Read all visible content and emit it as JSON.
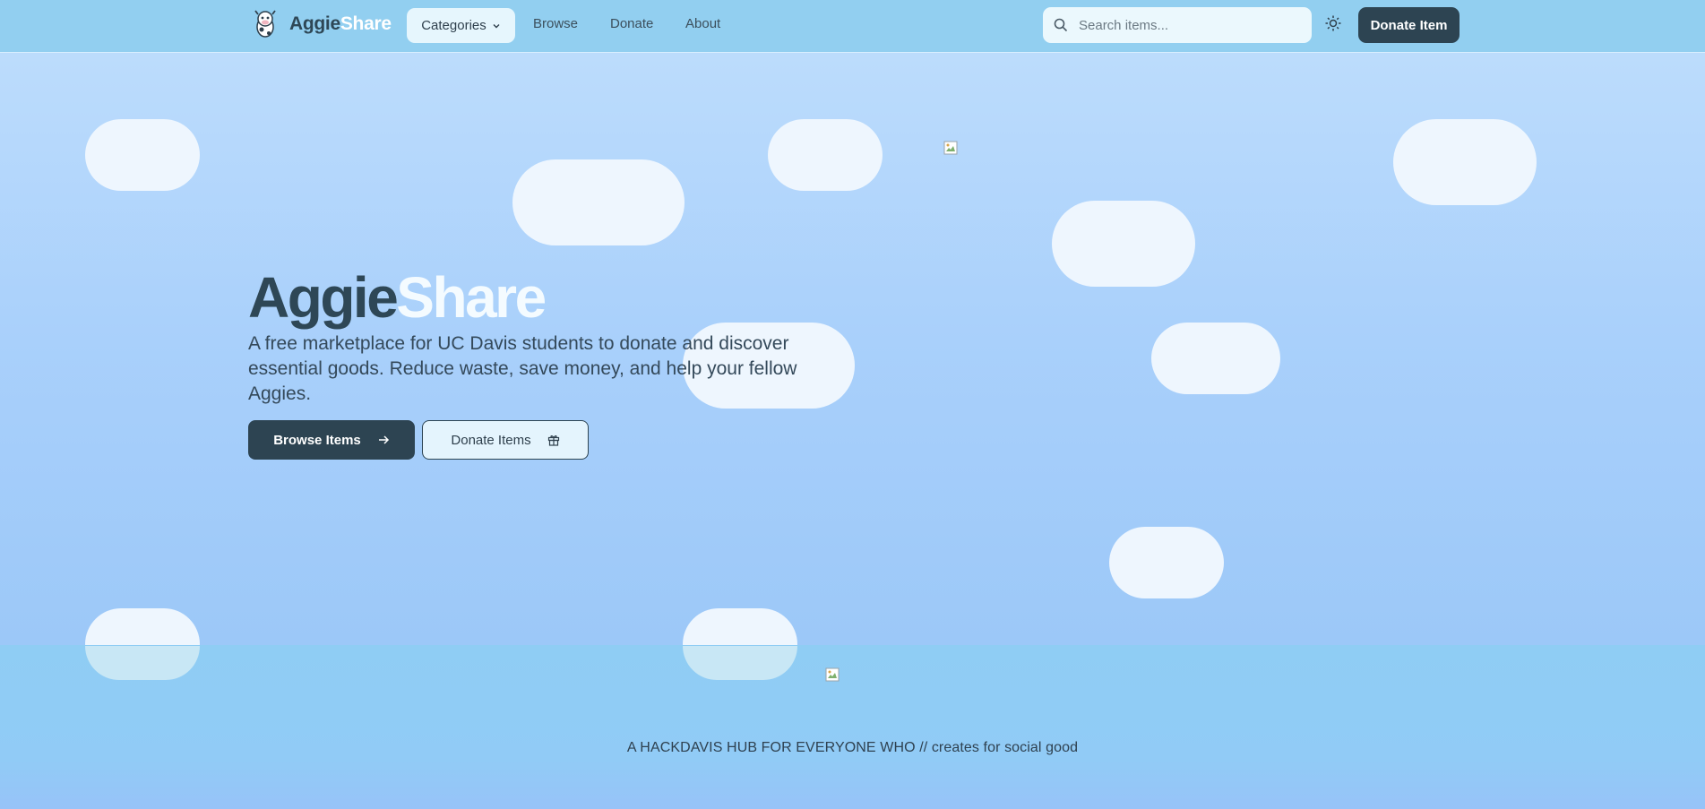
{
  "nav": {
    "brand_part1": "Aggie",
    "brand_part2": "Share",
    "categories_label": "Categories",
    "links": [
      "Browse",
      "Donate",
      "About"
    ],
    "search_placeholder": "Search items...",
    "donate_button": "Donate Item"
  },
  "hero": {
    "title_part1": "Aggie",
    "title_part2": "Share",
    "subtitle": "A free marketplace for UC Davis students to donate and discover essential goods. Reduce waste, save money, and help your fellow Aggies.",
    "browse_button": "Browse Items",
    "donate_button": "Donate Items"
  },
  "footer": {
    "tagline": "A HACKDAVIS HUB FOR EVERYONE WHO // creates for social good"
  },
  "icons": {
    "logo": "cow-mascot-icon",
    "categories": "chevron-down-icon",
    "search": "search-icon",
    "theme": "sun-icon",
    "browse": "arrow-right-icon",
    "donate": "gift-icon",
    "broken_image": "broken-image-icon"
  },
  "colors": {
    "navbar_bg": "#92cff0",
    "primary_dark": "#2d4452",
    "brand_white": "#ffffff",
    "cloud": "#eef6fe"
  }
}
